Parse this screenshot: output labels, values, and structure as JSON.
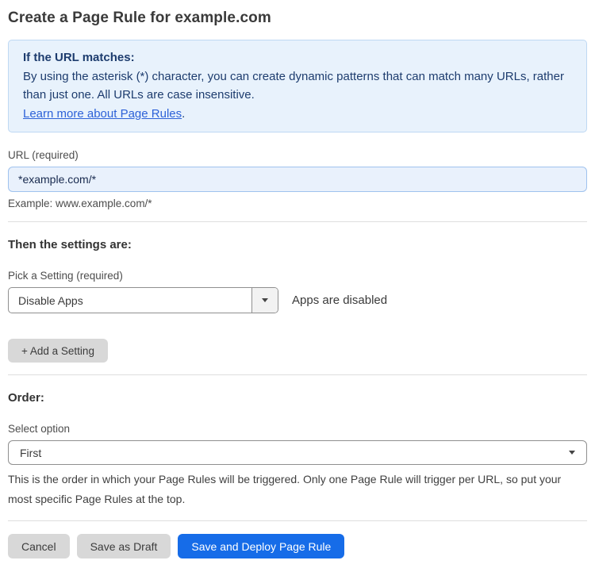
{
  "page": {
    "title": "Create a Page Rule for example.com"
  },
  "info_box": {
    "heading": "If the URL matches:",
    "body": "By using the asterisk (*) character, you can create dynamic patterns that can match many URLs, rather than just one. All URLs are case insensitive.",
    "link_text": "Learn more about Page Rules",
    "link_suffix": "."
  },
  "url_field": {
    "label": "URL (required)",
    "value": "*example.com/*",
    "example": "Example: www.example.com/*"
  },
  "settings_section": {
    "heading": "Then the settings are:",
    "picker_label": "Pick a Setting (required)",
    "selected_setting": "Disable Apps",
    "status_text": "Apps are disabled",
    "add_button_label": "+ Add a Setting"
  },
  "order_section": {
    "heading": "Order:",
    "select_label": "Select option",
    "selected_option": "First",
    "help_text": "This is the order in which your Page Rules will be triggered. Only one Page Rule will trigger per URL, so put your most specific Page Rules at the top."
  },
  "footer": {
    "cancel_label": "Cancel",
    "save_draft_label": "Save as Draft",
    "save_deploy_label": "Save and Deploy Page Rule"
  },
  "colors": {
    "primary_button_blue": "#166ce8",
    "info_box_background": "#e8f2fc",
    "info_box_border": "#bed8f3",
    "info_text_navy": "#1d3c6e",
    "link_blue": "#2d62d8",
    "input_background_blue": "#e9f1fc",
    "gray_button": "#d8d8d8"
  }
}
